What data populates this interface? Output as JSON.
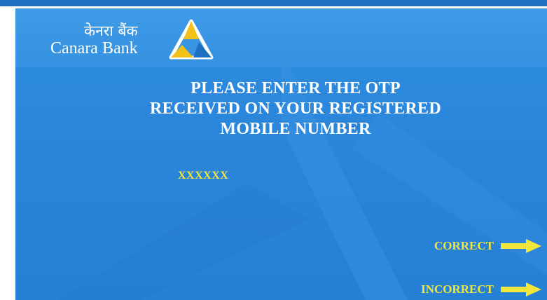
{
  "bank": {
    "name_hindi": "केनरा बैंक",
    "name_english": "Canara Bank",
    "logo_icon": "canara-triangle-logo"
  },
  "prompt": {
    "line1": "PLEASE ENTER THE OTP",
    "line2": "RECEIVED ON YOUR REGISTERED",
    "line3": "MOBILE NUMBER"
  },
  "otp": {
    "value": "XXXXXX"
  },
  "options": {
    "correct_label": "CORRECT",
    "incorrect_label": "INCORRECT",
    "arrow_icon": "right-arrow-icon"
  },
  "colors": {
    "screen_blue": "#2a86db",
    "highlight_yellow": "#f2e63a",
    "text_white": "#ffffff"
  }
}
